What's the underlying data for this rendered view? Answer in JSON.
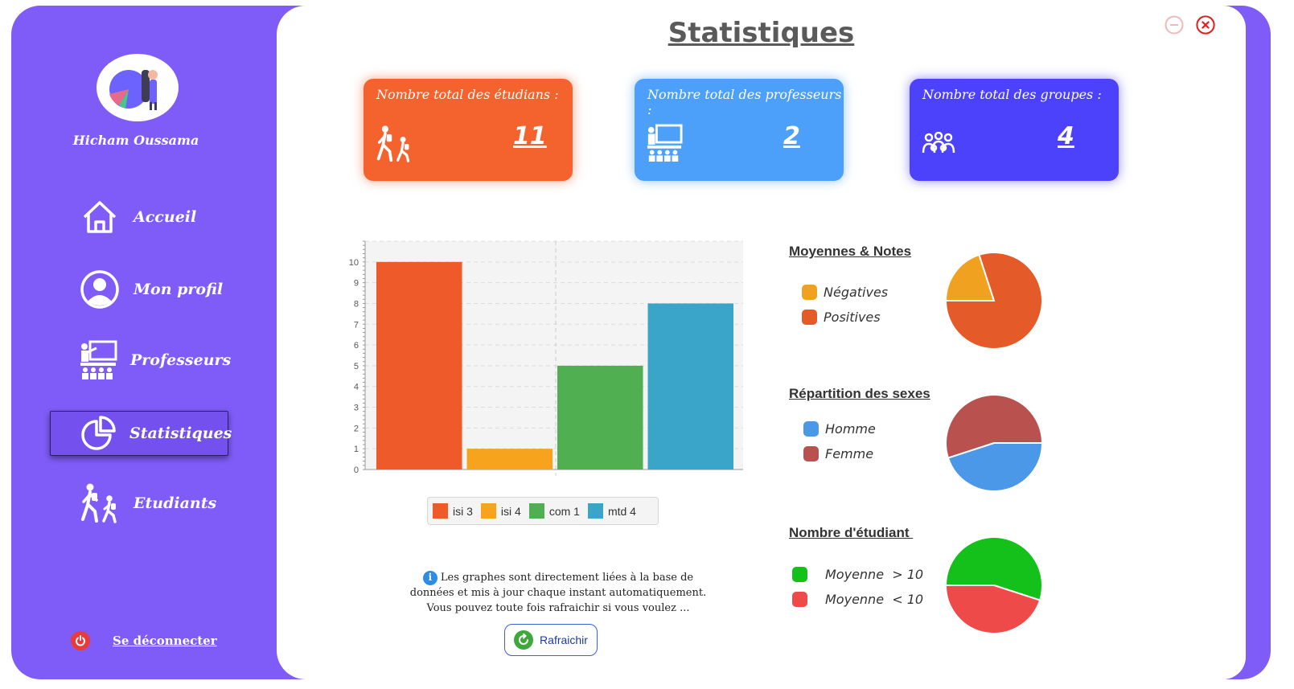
{
  "sidebar": {
    "username": "Hicham Oussama",
    "items": [
      {
        "label": "Accueil",
        "icon": "home-icon"
      },
      {
        "label": "Mon profil",
        "icon": "user-icon"
      },
      {
        "label": "Professeurs",
        "icon": "teacher-icon"
      },
      {
        "label": "Statistiques",
        "icon": "pie-chart-icon",
        "active": true
      },
      {
        "label": "Etudiants",
        "icon": "students-icon"
      }
    ],
    "logout_label": "Se déconnecter"
  },
  "header": {
    "title": "Statistiques"
  },
  "cards": [
    {
      "title": "Nombre total des étudians :",
      "value": "11",
      "color": "#f4622d",
      "icon": "students-icon"
    },
    {
      "title": "Nombre total des professeurs :",
      "value": "2",
      "color": "#4da0fa",
      "icon": "teacher-icon"
    },
    {
      "title": "Nombre total des groupes :",
      "value": "4",
      "color": "#4d42fb",
      "icon": "groups-icon"
    }
  ],
  "chart_data": [
    {
      "type": "bar",
      "categories": [
        "isi 3",
        "isi 4",
        "com 1",
        "mtd 4"
      ],
      "series": [
        {
          "name": "isi 3",
          "values": [
            10
          ],
          "color": "#ee5a2a"
        },
        {
          "name": "isi 4",
          "values": [
            1
          ],
          "color": "#f7a31e"
        },
        {
          "name": "com 1",
          "values": [
            5
          ],
          "color": "#4faf51"
        },
        {
          "name": "mtd 4",
          "values": [
            8
          ],
          "color": "#3aa4c9"
        }
      ],
      "ylim": [
        0,
        11
      ],
      "yticks": [
        "0",
        "1",
        "2",
        "3",
        "4",
        "5",
        "6",
        "7",
        "8",
        "9",
        "10"
      ],
      "grid": true,
      "legend": "bottom"
    },
    {
      "type": "pie",
      "title": "Moyennes & Notes",
      "slices": [
        {
          "label": "Négatives",
          "value": 20,
          "color": "#f0a11f"
        },
        {
          "label": "Positives",
          "value": 80,
          "color": "#e45a28"
        }
      ]
    },
    {
      "type": "pie",
      "title": "Répartition des sexes",
      "slices": [
        {
          "label": "Homme",
          "value": 45,
          "color": "#4b98e8"
        },
        {
          "label": "Femme",
          "value": 55,
          "color": "#b9524f"
        }
      ]
    },
    {
      "type": "pie",
      "title": "Nombre d'étudiant ",
      "slices": [
        {
          "label": "Moyenne  > 10",
          "value": 55,
          "color": "#13c11a"
        },
        {
          "label": "Moyenne  < 10",
          "value": 45,
          "color": "#ef4a4a"
        }
      ]
    }
  ],
  "info": {
    "line1": "Les graphes sont directement liées à la base de",
    "line2": "données et mis à jour chaque instant automatiquement.",
    "line3": "Vous pouvez toute fois rafraichir si vous voulez ...",
    "refresh_label": "Rafraichir"
  }
}
